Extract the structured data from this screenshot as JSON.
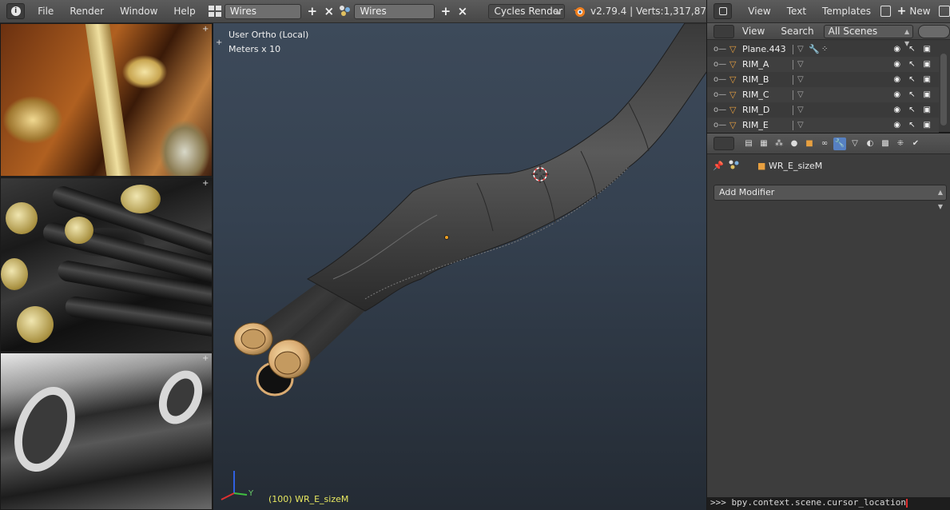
{
  "header": {
    "menus": [
      "File",
      "Render",
      "Window",
      "Help"
    ],
    "screen_layout": "Wires",
    "scene": "Wires",
    "render_engine": "Cycles Render",
    "stats": "v2.79.4 | Verts:1,317,87"
  },
  "viewport": {
    "view_name": "User Ortho (Local)",
    "scale": "Meters x 10",
    "status": "(100) WR_E_sizeM",
    "axis_x": "X",
    "axis_y": "Y"
  },
  "outliner": {
    "menus": [
      "View",
      "Text",
      "Templates"
    ],
    "new_label": "New",
    "tabs": [
      "View",
      "Search"
    ],
    "filter": "All Scenes",
    "items": [
      {
        "name": "Plane.443"
      },
      {
        "name": "RIM_A"
      },
      {
        "name": "RIM_B"
      },
      {
        "name": "RIM_C"
      },
      {
        "name": "RIM_D"
      },
      {
        "name": "RIM_E"
      }
    ]
  },
  "properties": {
    "object_name": "WR_E_sizeM",
    "add_modifier": "Add Modifier",
    "active_tab": "modifier-icon"
  },
  "console": {
    "text": ">>> bpy.context.scene.cursor_location"
  },
  "colors": {
    "accent": "#5680c2",
    "status_text": "#e8e860",
    "mesh_icon": "#e8a040"
  }
}
